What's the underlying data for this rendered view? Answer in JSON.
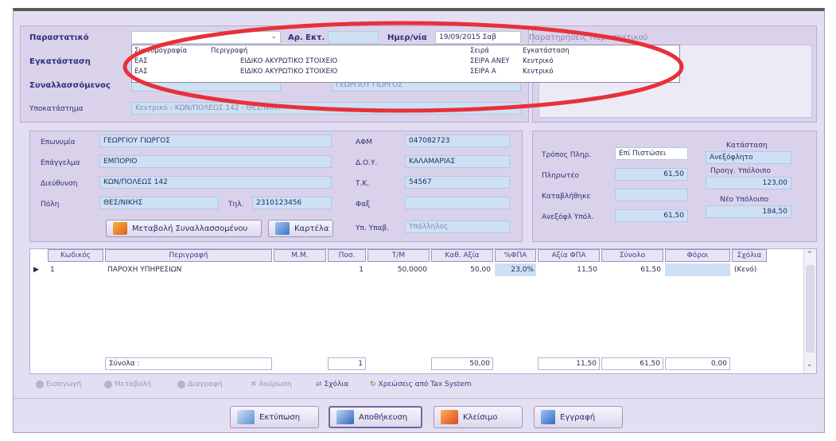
{
  "header": {
    "parastatiko_label": "Παραστατικό",
    "ar_ekt_label": "Αρ. Εκτ.",
    "imer_label": "Ημερ/νία",
    "date_value": "19/09/2015 Σαβ",
    "parastatiko_right": "Παρατηρήσεις Παραστατικού",
    "egkatastasi_label": "Εγκατάσταση",
    "synallassomenos_label": "Συναλλασσόμενος",
    "synallassomenos_value": "ΓΕΩΡΓΙΟΥ ΓΙΩΡΓΟΣ",
    "ypokatastima_label": "Υποκατάστημα",
    "ypokatastima_value": "Κεντρικό - ΚΩΝ/ΠΟΛΕΩΣ 142 - ΘΕΣ/ΝΙΚΗ"
  },
  "dropdown": {
    "columns": [
      "Συντομογραφία",
      "Περιγραφή",
      "Σειρά",
      "Εγκατάσταση"
    ],
    "rows": [
      [
        "ΕΑΣ",
        "ΕΙΔΙΚΟ ΑΚΥΡΩΤΙΚΟ ΣΤΟΙΧΕΙΟ",
        "ΣΕΙΡΑ ΑΝΕΥ",
        "Κεντρικό"
      ],
      [
        "ΕΑΣ",
        "ΕΙΔΙΚΟ ΑΚΥΡΩΤΙΚΟ ΣΤΟΙΧΕΙΟ",
        "ΣΕΙΡΑ Α",
        "Κεντρικό"
      ]
    ]
  },
  "customer": {
    "eponymia_label": "Επωνυμία",
    "eponymia": "ΓΕΩΡΓΙΟΥ ΓΙΩΡΓΟΣ",
    "epaggelma_label": "Επάγγελμα",
    "epaggelma": "ΕΜΠΟΡΙΟ",
    "dieuthynsi_label": "Διεύθυνση",
    "dieuthynsi": "ΚΩΝ/ΠΟΛΕΩΣ 142",
    "poli_label": "Πόλη",
    "poli": "ΘΕΣ/ΝΙΚΗΣ",
    "til_label": "Τηλ.",
    "til": "2310123456",
    "afm_label": "ΑΦΜ",
    "afm": "047082723",
    "doy_label": "Δ.Ο.Υ.",
    "doy": "ΚΑΛΑΜΑΡΙΑΣ",
    "tk_label": "Τ.Κ.",
    "tk": "54567",
    "fax_label": "Φαξ",
    "fax": "",
    "yp_label": "Υπ. Υπαβ.",
    "yp_value": "Υπάλληλος",
    "btn_change": "Μεταβολή Συναλλασσομένου",
    "btn_kartela": "Καρτέλα"
  },
  "payment": {
    "tropos_label": "Τρόπος Πληρ.",
    "tropos": "Επί Πιστώσει",
    "pliroteo_label": "Πληρωτέο",
    "pliroteo": "61,50",
    "katavlithike_label": "Καταβλήθηκε",
    "katavlithike": "",
    "anexofl_label": "Ανεξόφλ Υπόλ.",
    "anexofl": "61,50",
    "katastasi_label": "Κατάσταση",
    "katastasi": "Ανεξόφλητο",
    "proig_label": "Προηγ. Υπόλοιπο",
    "proig": "123,00",
    "neo_label": "Νέο Υπόλοιπο",
    "neo": "184,50"
  },
  "grid": {
    "columns": [
      "Κωδικός",
      "Περιγραφή",
      "Μ.Μ.",
      "Ποσ.",
      "Τ/Μ",
      "Καθ. Αξία",
      "%ΦΠΑ",
      "Αξία ΦΠΑ",
      "Σύνολο",
      "Φόροι",
      "Σχόλια"
    ],
    "row": [
      "1",
      "ΠΑΡΟΧΗ ΥΠΗΡΕΣΙΩΝ",
      "",
      "1",
      "50,0000",
      "50,00",
      "23,0%",
      "11,50",
      "61,50",
      "",
      "(Κενό)"
    ],
    "totals_label": "Σύνολα :",
    "totals": {
      "qty": "1",
      "kath": "50,00",
      "fpa": "11,50",
      "synolo": "61,50",
      "foroi": "0,00"
    }
  },
  "line_toolbar": {
    "items": [
      "Εισαγωγή",
      "Μεταβολή",
      "Διαγραφή",
      "Ακύρωση",
      "Σχόλια",
      "Χρεώσεις από Tax System"
    ]
  },
  "footer": {
    "print": "Εκτύπωση",
    "save": "Αποθήκευση",
    "close": "Κλείσιμο",
    "register": "Εγγραφή"
  }
}
